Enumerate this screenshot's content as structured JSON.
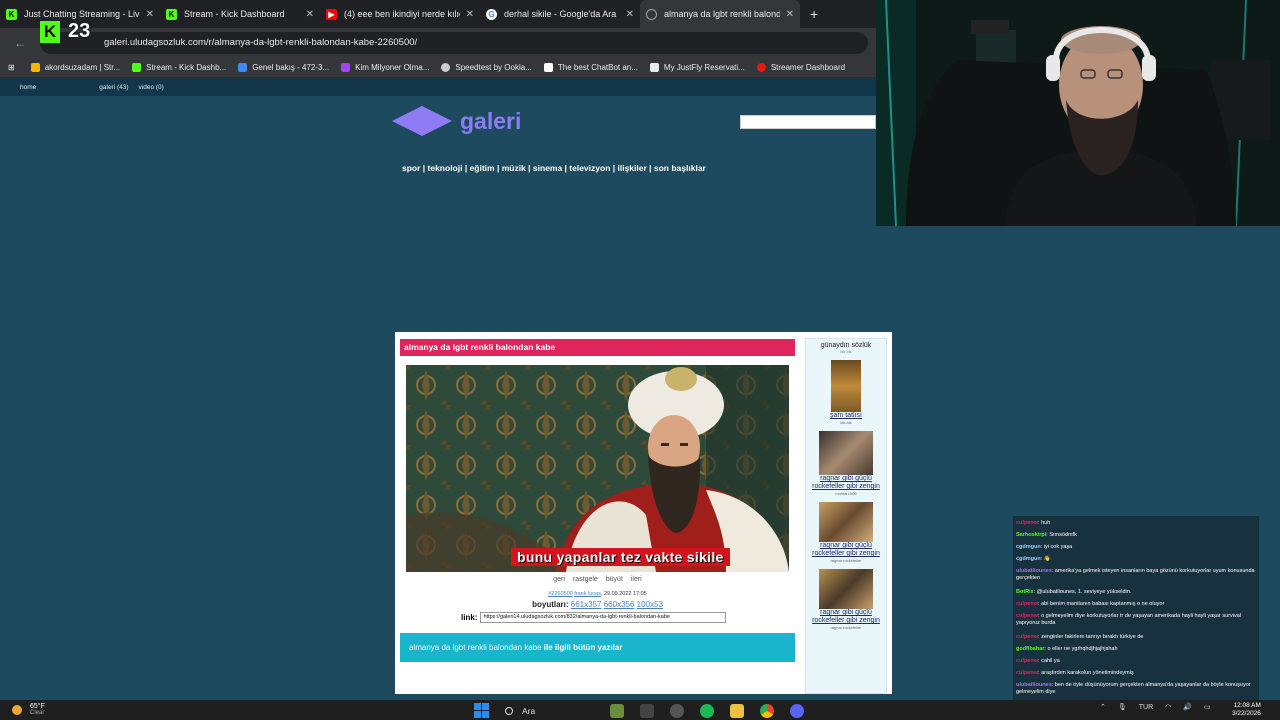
{
  "browser": {
    "tabs": [
      {
        "label": "Just Chatting Streaming - Live S",
        "icon": "kick-icon",
        "color": "#53fc18",
        "active": false
      },
      {
        "label": "Stream - Kick Dashboard",
        "icon": "kick-icon",
        "color": "#53fc18",
        "active": false
      },
      {
        "label": "(4) eee ben ikindiyi nerde kılıca",
        "icon": "youtube-icon",
        "color": "#ff0000",
        "active": false
      },
      {
        "label": "derhal sikile - Google'da Ara",
        "icon": "google-icon",
        "color": "#4285f4",
        "active": false
      },
      {
        "label": "almanya da lgbt renkli balondar",
        "icon": "globe-icon",
        "color": "#9aa0a6",
        "active": true
      }
    ],
    "new_tab": "+",
    "url": "galeri.uludagsozluk.com/r/almanya-da-lgbt-renkli-balondan-kabe-2260500/",
    "bookmarks": [
      {
        "label": "akordsuzadam | Str...",
        "color": "#f4b400"
      },
      {
        "label": "Stream - Kick Dashb...",
        "color": "#53fc18"
      },
      {
        "label": "Genel bakış - 472-3...",
        "color": "#4285f4"
      },
      {
        "label": "Kim Milyoner Olma...",
        "color": "#a142f4"
      },
      {
        "label": "Speedtest by Ookla...",
        "color": "#cccccc"
      },
      {
        "label": "The best ChatBot an...",
        "color": "#ffffff"
      },
      {
        "label": "My JustFly Reservati...",
        "color": "#e8eaed"
      },
      {
        "label": "Streamer Dashboard",
        "color": "#e91916"
      }
    ]
  },
  "kick_badge": {
    "count": "23"
  },
  "site": {
    "topnav": [
      "home",
      "galeri (43)",
      "video (0)"
    ],
    "logo_text": "galeri",
    "categories": "spor | teknoloji | eğitim | müzik | sinema | televizyon | ilişkiler | son başlıklar"
  },
  "post": {
    "title": "almanya da lgbt renkli balondan kabe",
    "caption": "bunu yapanlar tez vakte sikile",
    "nav": [
      "geri",
      "rastgele",
      "büyüt",
      "ileri"
    ],
    "id": "#2260500",
    "author": "frank lucas",
    "date": "29.09.2022 17:05",
    "sizes_label": "boyutları:",
    "sizes": [
      "661x357",
      "660x356",
      "100x53"
    ],
    "link_label": "link:",
    "link_value": "https://galeri14.uludagsozluk.com/832/almanya-da-lgbt-renkli-balondan-kabe",
    "related_prefix": "almanya da lgbt renkli balondan kabe",
    "related_suffix": "ile ilgili bütün yazılar"
  },
  "sidebar": {
    "heading": "günaydın sözlük",
    "heading_sub": "bik bik",
    "items": [
      {
        "title": "şam tatlısı",
        "sub": "bik bik"
      },
      {
        "title": "ragnar gibi güçlü rockefeller gibi zengin",
        "sub": "muhtar1906"
      },
      {
        "title": "ragnar gibi güçlü rockefeller gibi zengin",
        "sub": "ragnar rockefeller"
      },
      {
        "title": "ragnar gibi güçlü rockefeller gibi zengin",
        "sub": "ragnar rockefeller"
      }
    ]
  },
  "chat": [
    {
      "user": "сulpenw",
      "color": "#e0245e",
      "text": ": huh"
    },
    {
      "user": "Sarhoskirpi",
      "color": "#53fc18",
      "text": ": Sımsödmfk"
    },
    {
      "user": "cgdmgun",
      "color": "#9ad0ff",
      "text": ": iyi cok yaşa"
    },
    {
      "user": "cgdmgun",
      "color": "#9ad0ff",
      "text": ": 👋"
    },
    {
      "user": "ulubatliounes",
      "color": "#b06cff",
      "text": ": amerika'ya gelmek isteyen insanların baya gözünü korkutuyorlar uyum konusunda gerçekten"
    },
    {
      "user": "BotRix",
      "color": "#53fc18",
      "text": ": @ulubatliounes, 1. seviyeye yükseldin."
    },
    {
      "user": "сulpenw",
      "color": "#e0245e",
      "text": ": abi benim manitanın babası kaptanmış o ne oluyor"
    },
    {
      "user": "сulpenw",
      "color": "#e0245e",
      "text": ": o gelmeyelim diye korkutuyorlar tr de yaşayan amerikada hayli hayli yaşar survival yapıyoruz burda"
    },
    {
      "user": "сulpenw",
      "color": "#e0245e",
      "text": ": zenginler fakirlere tanrıyı bıraktı türkiye de"
    },
    {
      "user": "godfibahar",
      "color": "#53fc18",
      "text": ": o eller ne ygrhqhdjhjajhjshah"
    },
    {
      "user": "сulpenw",
      "color": "#e0245e",
      "text": ": cahil ya"
    },
    {
      "user": "сulpenw",
      "color": "#e0245e",
      "text": ": araştırdım karakolun yönetimindeymiş"
    },
    {
      "user": "ulubatliounes",
      "color": "#b06cff",
      "text": ": ben de öyle düşünüyorum gerçekten almanya'da yaşayanlar da böyle konuşuyor gelmeyelim diye"
    }
  ],
  "taskbar": {
    "weather_temp": "65°F",
    "weather_desc": "Clear",
    "search_label": "Ara",
    "lang": "TUR",
    "time": "12:08 AM",
    "date": "3/22/2026"
  }
}
